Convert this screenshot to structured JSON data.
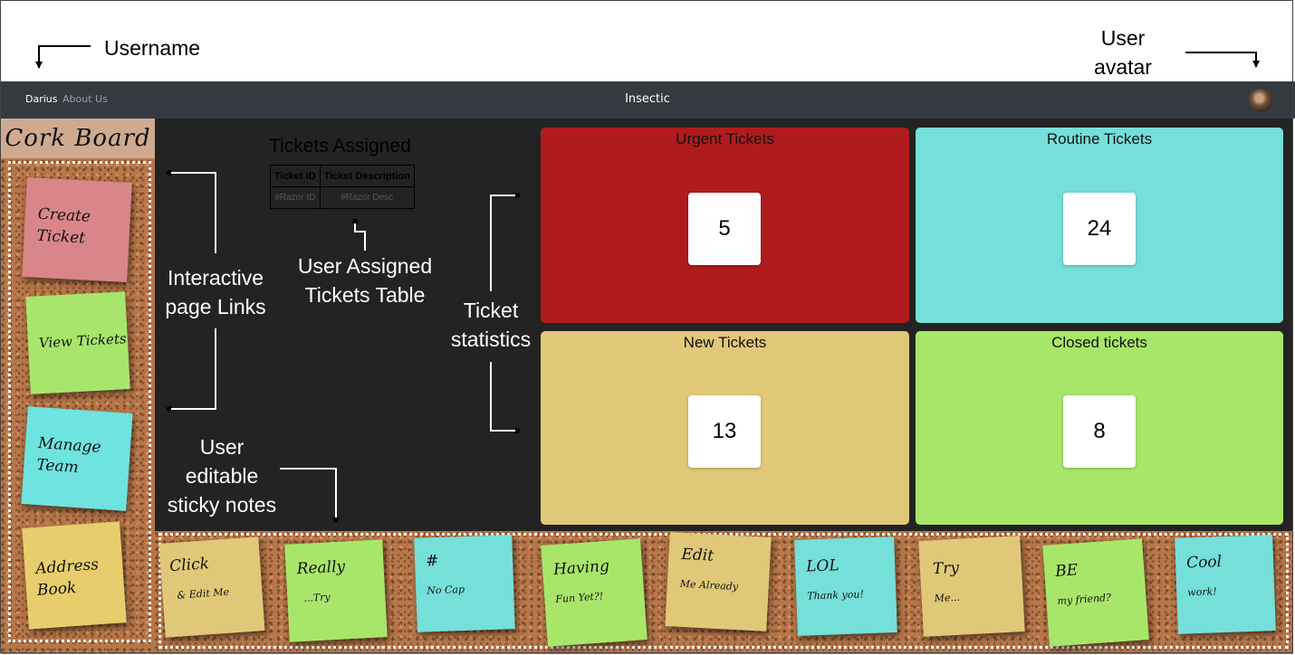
{
  "annotations": {
    "username": "Username",
    "user_avatar_line1": "User",
    "user_avatar_line2": "avatar",
    "page_links_line1": "Interactive",
    "page_links_line2": "page Links",
    "tickets_table_line1": "User Assigned",
    "tickets_table_line2": "Tickets Table",
    "ticket_stats_line1": "Ticket",
    "ticket_stats_line2": "statistics",
    "sticky_notes_line1": "User",
    "sticky_notes_line2": "editable",
    "sticky_notes_line3": "sticky notes"
  },
  "navbar": {
    "username": "Darius",
    "about": "About Us",
    "brand": "Insectic",
    "avatar_icon": "user-avatar"
  },
  "sidebar": {
    "title": "Cork Board",
    "links": [
      {
        "label": "Create\nTicket",
        "color": "#d9868a"
      },
      {
        "label": "View Tickets",
        "color": "#a7e66b"
      },
      {
        "label": "Manage\nTeam",
        "color": "#6fe3e0"
      },
      {
        "label": "Address\nBook",
        "color": "#e8cd6d"
      }
    ]
  },
  "tickets_table": {
    "title": "Tickets Assigned",
    "headers": [
      "Ticket ID",
      "Ticket Description"
    ],
    "rows": [
      [
        "#Razor ID",
        "#Razor Desc"
      ]
    ]
  },
  "stats": {
    "urgent": {
      "title": "Urgent Tickets",
      "count": "5",
      "color": "#b01c1d"
    },
    "routine": {
      "title": "Routine Tickets",
      "count": "24",
      "color": "#75dfd9"
    },
    "new": {
      "title": "New Tickets",
      "count": "13",
      "color": "#e0c878"
    },
    "closed": {
      "title": "Closed tickets",
      "count": "8",
      "color": "#a8e66a"
    }
  },
  "sticky_notes": [
    {
      "title": "Click",
      "body": "& Edit Me",
      "color": "#e0c878"
    },
    {
      "title": "Really",
      "body": "...Try",
      "color": "#a8e66a"
    },
    {
      "title": "#",
      "body": "No Cap",
      "color": "#75dfd9"
    },
    {
      "title": "Having",
      "body": "Fun Yet?!",
      "color": "#a8e66a"
    },
    {
      "title": "Edit",
      "body": "Me Already",
      "color": "#e0c878"
    },
    {
      "title": "LOL",
      "body": "Thank you!",
      "color": "#75dfd9"
    },
    {
      "title": "Try",
      "body": "Me...",
      "color": "#e0c878"
    },
    {
      "title": "BE",
      "body": "my friend?",
      "color": "#a8e66a"
    },
    {
      "title": "Cool",
      "body": "work!",
      "color": "#75dfd9"
    }
  ]
}
